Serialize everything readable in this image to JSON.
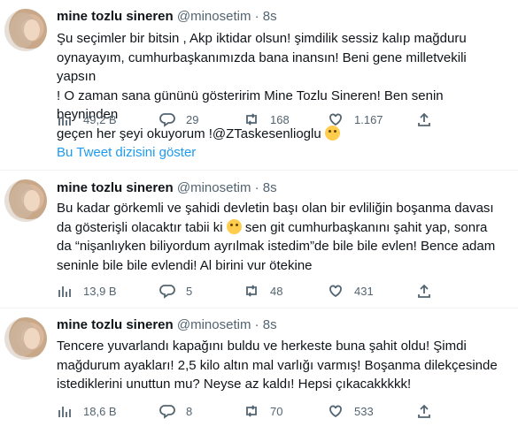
{
  "tweets": [
    {
      "name": "mine tozlu sineren",
      "handle": "@minosetim",
      "dot": "·",
      "time": "8s",
      "text": "Şu seçimler bir bitsin , Akp iktidar olsun!  şimdilik sessiz kalıp mağduru\noynayayım, cumhurbaşkanımızda bana inansın! Beni gene milletvekili yapsın\n! O zaman sana gününü gösteririm Mine Tozlu Sineren! Ben senin beyninden\ngeçen her şeyi okuyorum !@ZTaskesenlioglu",
      "emoji": "face-with-tears-of-joy",
      "views": "49,2 B",
      "replies": "29",
      "retweets": "168",
      "likes": "1.167"
    },
    {
      "name": "mine tozlu sineren",
      "handle": "@minosetim",
      "dot": "·",
      "time": "8s",
      "text_a": "Bu kadar görkemli ve şahidi devletin başı olan bir evliliğin boşanma davası\nda gösterişli olacaktır tabii ki ",
      "text_b": " sen git cumhurbaşkanını şahit yap, sonra\nda “nişanlıyken biliyordum ayrılmak istedim”de bile bile evlen! Bence adam\nseninle bile bile evlendi! Al birini vur ötekine",
      "emoji": "rolling-eyes-face",
      "views": "13,9 B",
      "replies": "5",
      "retweets": "48",
      "likes": "431"
    },
    {
      "name": "mine tozlu sineren",
      "handle": "@minosetim",
      "dot": "·",
      "time": "8s",
      "text": "Tencere yuvarlandı kapağını buldu ve herkeste buna şahit oldu! Şimdi\nmağdurum ayakları! 2,5 kilo altın mal varlığı varmış! Boşanma dilekçesinde\nistediklerini unuttun mu? Neyse az kaldı! Hepsi çıkacakkkkk!",
      "views": "18,6 B",
      "replies": "8",
      "retweets": "70",
      "likes": "533"
    }
  ],
  "thread_link": "Bu Tweet dizisini göster"
}
